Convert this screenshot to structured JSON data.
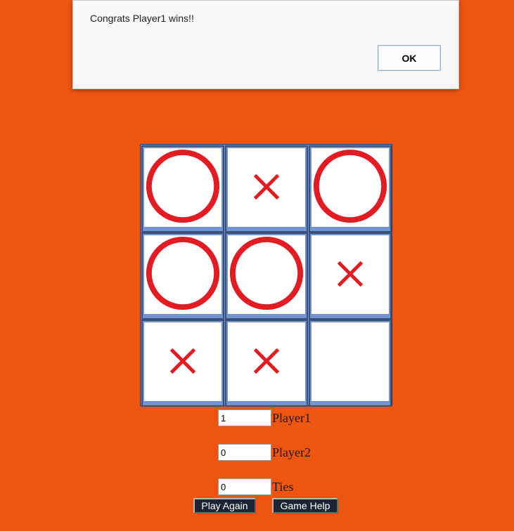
{
  "alert": {
    "message": "Congrats Player1 wins!!",
    "ok_label": "OK"
  },
  "board": {
    "cells": [
      "O",
      "X",
      "O",
      "O",
      "O",
      "X",
      "X",
      "X",
      ""
    ],
    "mark_color": "#e31b23"
  },
  "scores": [
    {
      "value": "1",
      "label": "Player1"
    },
    {
      "value": "0",
      "label": "Player2"
    },
    {
      "value": "0",
      "label": "Ties"
    }
  ],
  "buttons": {
    "play_again": "Play Again",
    "game_help": "Game Help"
  },
  "colors": {
    "background": "#ee5610",
    "board": "#6f94cf",
    "button": "#1a2432"
  }
}
